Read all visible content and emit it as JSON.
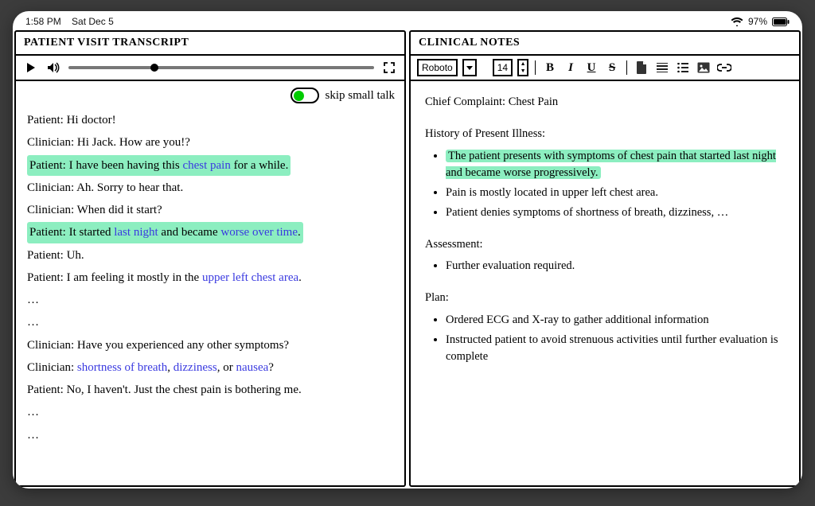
{
  "status": {
    "time": "1:58 PM",
    "date": "Sat Dec 5",
    "battery": "97%"
  },
  "left": {
    "title": "PATIENT VISIT TRANSCRIPT",
    "skip_label": "skip small talk",
    "lines": [
      {
        "speaker": "Patient",
        "prefix": "Patient: ",
        "parts": [
          {
            "t": "Hi doctor!"
          }
        ],
        "hl": false
      },
      {
        "speaker": "Clinician",
        "prefix": "Clinician: ",
        "parts": [
          {
            "t": "Hi Jack. How are you!?"
          }
        ],
        "hl": false
      },
      {
        "speaker": "Patient",
        "prefix": "Patient: ",
        "parts": [
          {
            "t": "I have been having this "
          },
          {
            "t": "chest pain",
            "kw": true
          },
          {
            "t": " for a while."
          }
        ],
        "hl": true
      },
      {
        "speaker": "Clinician",
        "prefix": "Clinician: ",
        "parts": [
          {
            "t": "Ah. Sorry to hear that."
          }
        ],
        "hl": false
      },
      {
        "speaker": "Clinician",
        "prefix": "Clinician: ",
        "parts": [
          {
            "t": "When did it start?"
          }
        ],
        "hl": false
      },
      {
        "speaker": "Patient",
        "prefix": "Patient: ",
        "parts": [
          {
            "t": "It started "
          },
          {
            "t": "last night",
            "kw": true
          },
          {
            "t": " and became "
          },
          {
            "t": "worse over time",
            "kw": true
          },
          {
            "t": "."
          }
        ],
        "hl": true
      },
      {
        "speaker": "Patient",
        "prefix": "Patient: ",
        "parts": [
          {
            "t": "Uh."
          }
        ],
        "hl": false
      },
      {
        "speaker": "Patient",
        "prefix": "Patient: ",
        "parts": [
          {
            "t": "I am feeling it mostly in the "
          },
          {
            "t": "upper left chest area",
            "kw": true
          },
          {
            "t": "."
          }
        ],
        "hl": false
      },
      {
        "speaker": "",
        "prefix": "",
        "parts": [
          {
            "t": "…"
          }
        ],
        "hl": false,
        "ell": true
      },
      {
        "speaker": "",
        "prefix": "",
        "parts": [
          {
            "t": "…"
          }
        ],
        "hl": false,
        "ell": true
      },
      {
        "speaker": "Clinician",
        "prefix": "Clinician: ",
        "parts": [
          {
            "t": "Have you experienced any other symptoms?"
          }
        ],
        "hl": false
      },
      {
        "speaker": "Clinician",
        "prefix": "Clinician: ",
        "parts": [
          {
            "t": "shortness of breath",
            "kw": true
          },
          {
            "t": ", "
          },
          {
            "t": "dizziness",
            "kw": true
          },
          {
            "t": ", or "
          },
          {
            "t": "nausea",
            "kw": true
          },
          {
            "t": "?"
          }
        ],
        "hl": false
      },
      {
        "speaker": "Patient",
        "prefix": "Patient: ",
        "parts": [
          {
            "t": "No, I haven't. Just the chest pain is bothering me."
          }
        ],
        "hl": false
      },
      {
        "speaker": "",
        "prefix": "",
        "parts": [
          {
            "t": "…"
          }
        ],
        "hl": false,
        "ell": true
      },
      {
        "speaker": "",
        "prefix": "",
        "parts": [
          {
            "t": "…"
          }
        ],
        "hl": false,
        "ell": true
      }
    ]
  },
  "right": {
    "title": "CLINICAL NOTES",
    "toolbar": {
      "font": "Roboto",
      "size": "14",
      "bold": "B",
      "italic": "I",
      "underline": "U",
      "strike": "S"
    },
    "sections": [
      {
        "title": "Chief Complaint: Chest Pain",
        "items": []
      },
      {
        "title": "History of Present Illness:",
        "items": [
          {
            "t": "The patient presents with symptoms of chest pain that started last night and became worse progressively.",
            "hl": true
          },
          {
            "t": "Pain is mostly located in upper left chest area."
          },
          {
            "t": "Patient denies symptoms of shortness of breath, dizziness, …"
          }
        ]
      },
      {
        "title": "Assessment:",
        "items": [
          {
            "t": "Further evaluation required."
          }
        ]
      },
      {
        "title": "Plan:",
        "items": [
          {
            "t": "Ordered ECG and X-ray to gather additional information"
          },
          {
            "t": "Instructed patient to avoid strenuous activities until further evaluation is complete"
          }
        ]
      }
    ]
  }
}
